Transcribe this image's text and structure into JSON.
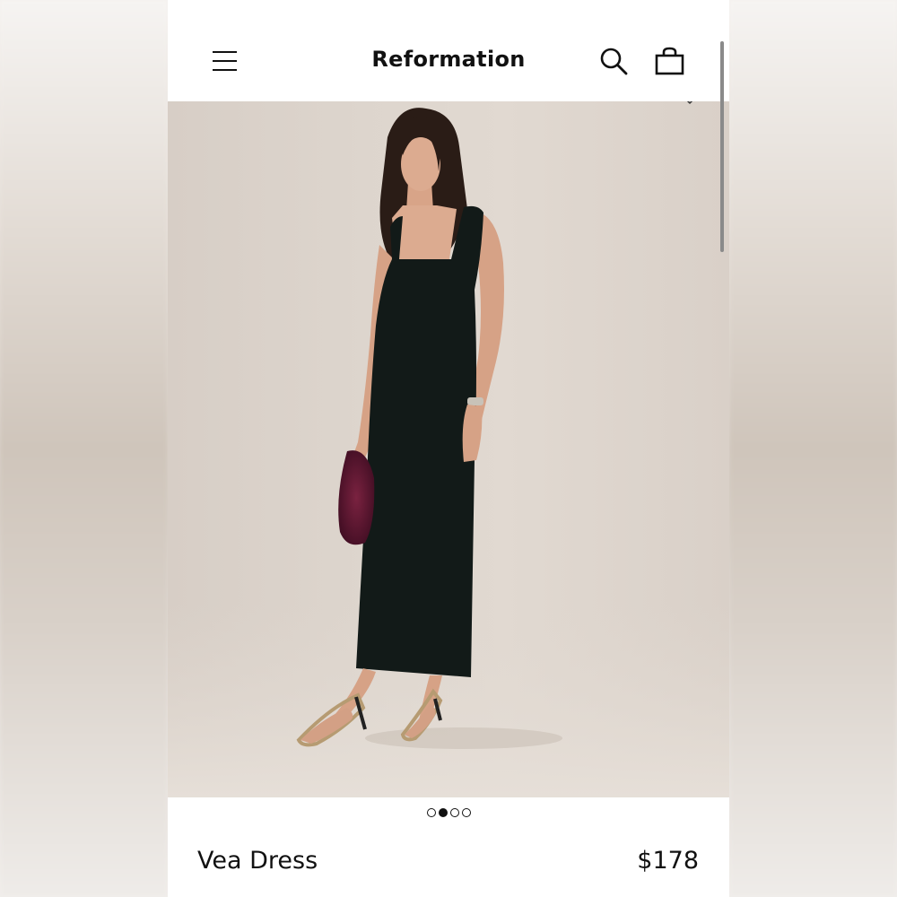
{
  "header": {
    "brand": "Reformation",
    "menu_icon": "hamburger-menu-icon",
    "search_icon": "search-icon",
    "bag_icon": "shopping-bag-icon"
  },
  "gallery": {
    "image_count": 4,
    "active_index": 1,
    "dress_color": "#121a18",
    "background_color": "#ddd5cd",
    "bag_color": "#5a1630"
  },
  "product": {
    "name": "Vea Dress",
    "price": "$178"
  }
}
